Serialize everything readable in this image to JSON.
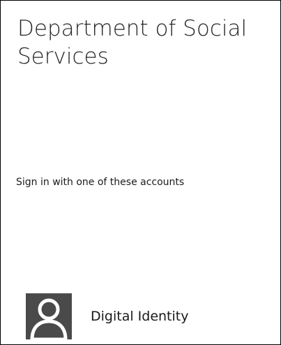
{
  "header": {
    "organization_name": "Department of Social Services"
  },
  "main": {
    "prompt": "Sign in with one of these accounts",
    "accounts": [
      {
        "label": "Digital Identity",
        "icon": "user-avatar-icon"
      }
    ]
  },
  "colors": {
    "avatar_background": "#4a4a4a",
    "avatar_figure": "#ffffff",
    "text": "#262626",
    "border": "#000000"
  }
}
